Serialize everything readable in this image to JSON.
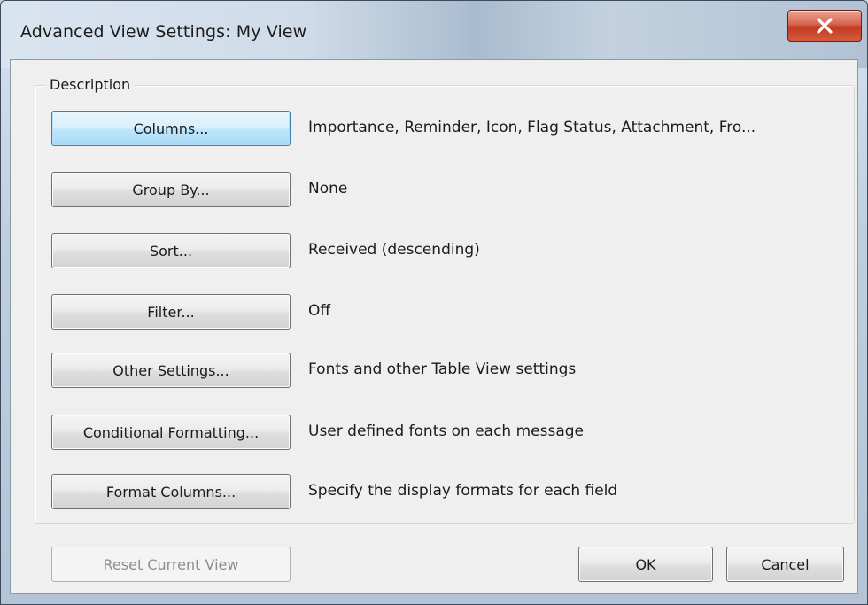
{
  "window": {
    "title": "Advanced View Settings: My View",
    "close_icon": "close-icon"
  },
  "group": {
    "label": "Description"
  },
  "rows": [
    {
      "button": "Columns...",
      "description": "Importance, Reminder, Icon, Flag Status, Attachment, Fro..."
    },
    {
      "button": "Group By...",
      "description": "None"
    },
    {
      "button": "Sort...",
      "description": "Received (descending)"
    },
    {
      "button": "Filter...",
      "description": "Off"
    },
    {
      "button": "Other Settings...",
      "description": "Fonts and other Table View settings"
    },
    {
      "button": "Conditional Formatting...",
      "description": "User defined fonts on each message"
    },
    {
      "button": "Format Columns...",
      "description": "Specify the display formats for each field"
    }
  ],
  "footer": {
    "reset_label": "Reset Current View",
    "ok_label": "OK",
    "cancel_label": "Cancel"
  },
  "colors": {
    "focus_border": "#3c7fb1",
    "close_red": "#c23a22"
  }
}
